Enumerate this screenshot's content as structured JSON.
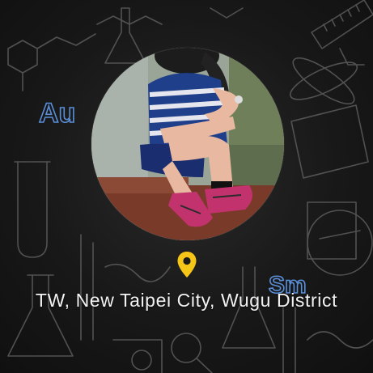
{
  "profile": {
    "avatar_alt": "profile photo",
    "location_text": "TW, New Taipei City, Wugu District"
  },
  "background": {
    "doodle_labels": [
      "Au",
      "Sm"
    ]
  },
  "colors": {
    "pin": "#f5c518",
    "background": "#141414",
    "text": "#f2f2f2"
  },
  "icons": {
    "location": "map-pin-icon"
  }
}
